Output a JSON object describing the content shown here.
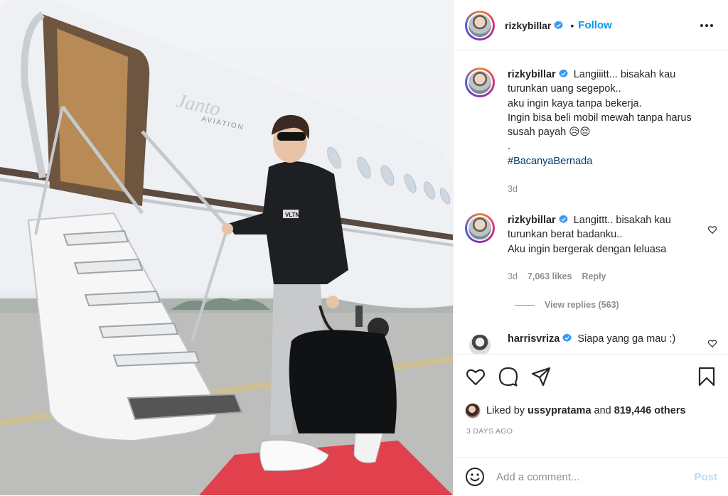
{
  "post": {
    "author": {
      "username": "rizkybillar",
      "verified": true,
      "follow_label": "Follow",
      "separator": "•"
    },
    "photo": {
      "aircraft_logo_text": "Janto",
      "aircraft_logo_subtext": "AVIATION",
      "jacket_patch_text": "VLTN"
    },
    "caption": {
      "username": "rizkybillar",
      "line1": "Langiiitt... bisakah kau",
      "line2": "turunkan uang segepok..",
      "line3": "aku ingin kaya tanpa bekerja.",
      "line4": "Ingin bisa beli mobil mewah tanpa harus",
      "line5": "susah payah 😥😔",
      "line6": ".",
      "hashtag": "#BacanyaBernada",
      "age": "3d"
    },
    "comments": [
      {
        "username": "rizkybillar",
        "verified": true,
        "line1": "Langittt.. bisakah kau",
        "line2": "turunkan berat badanku..",
        "line3": "Aku ingin bergerak dengan leluasa",
        "age": "3d",
        "likes": "7,063 likes",
        "reply_label": "Reply",
        "view_replies": "View replies (563)"
      },
      {
        "username": "harrisvriza",
        "verified": true,
        "text": "Siapa yang ga mau :)"
      }
    ],
    "liked_by": {
      "prefix": "Liked by",
      "user": "ussypratama",
      "conjunction": "and",
      "others": "819,446 others"
    },
    "timestamp": "3 DAYS AGO",
    "add_comment": {
      "placeholder": "Add a comment...",
      "post_label": "Post"
    },
    "icons": {
      "more": "more-options-icon",
      "like": "heart-icon",
      "comment": "comment-icon",
      "share": "share-icon",
      "save": "bookmark-icon",
      "emoji": "emoji-icon"
    },
    "colors": {
      "link": "#0095f6",
      "hashtag": "#00376b",
      "muted": "#8e8e8e",
      "verified": "#3897f0",
      "post_disabled": "#b2dffc",
      "carpet": "#e0414d"
    }
  }
}
